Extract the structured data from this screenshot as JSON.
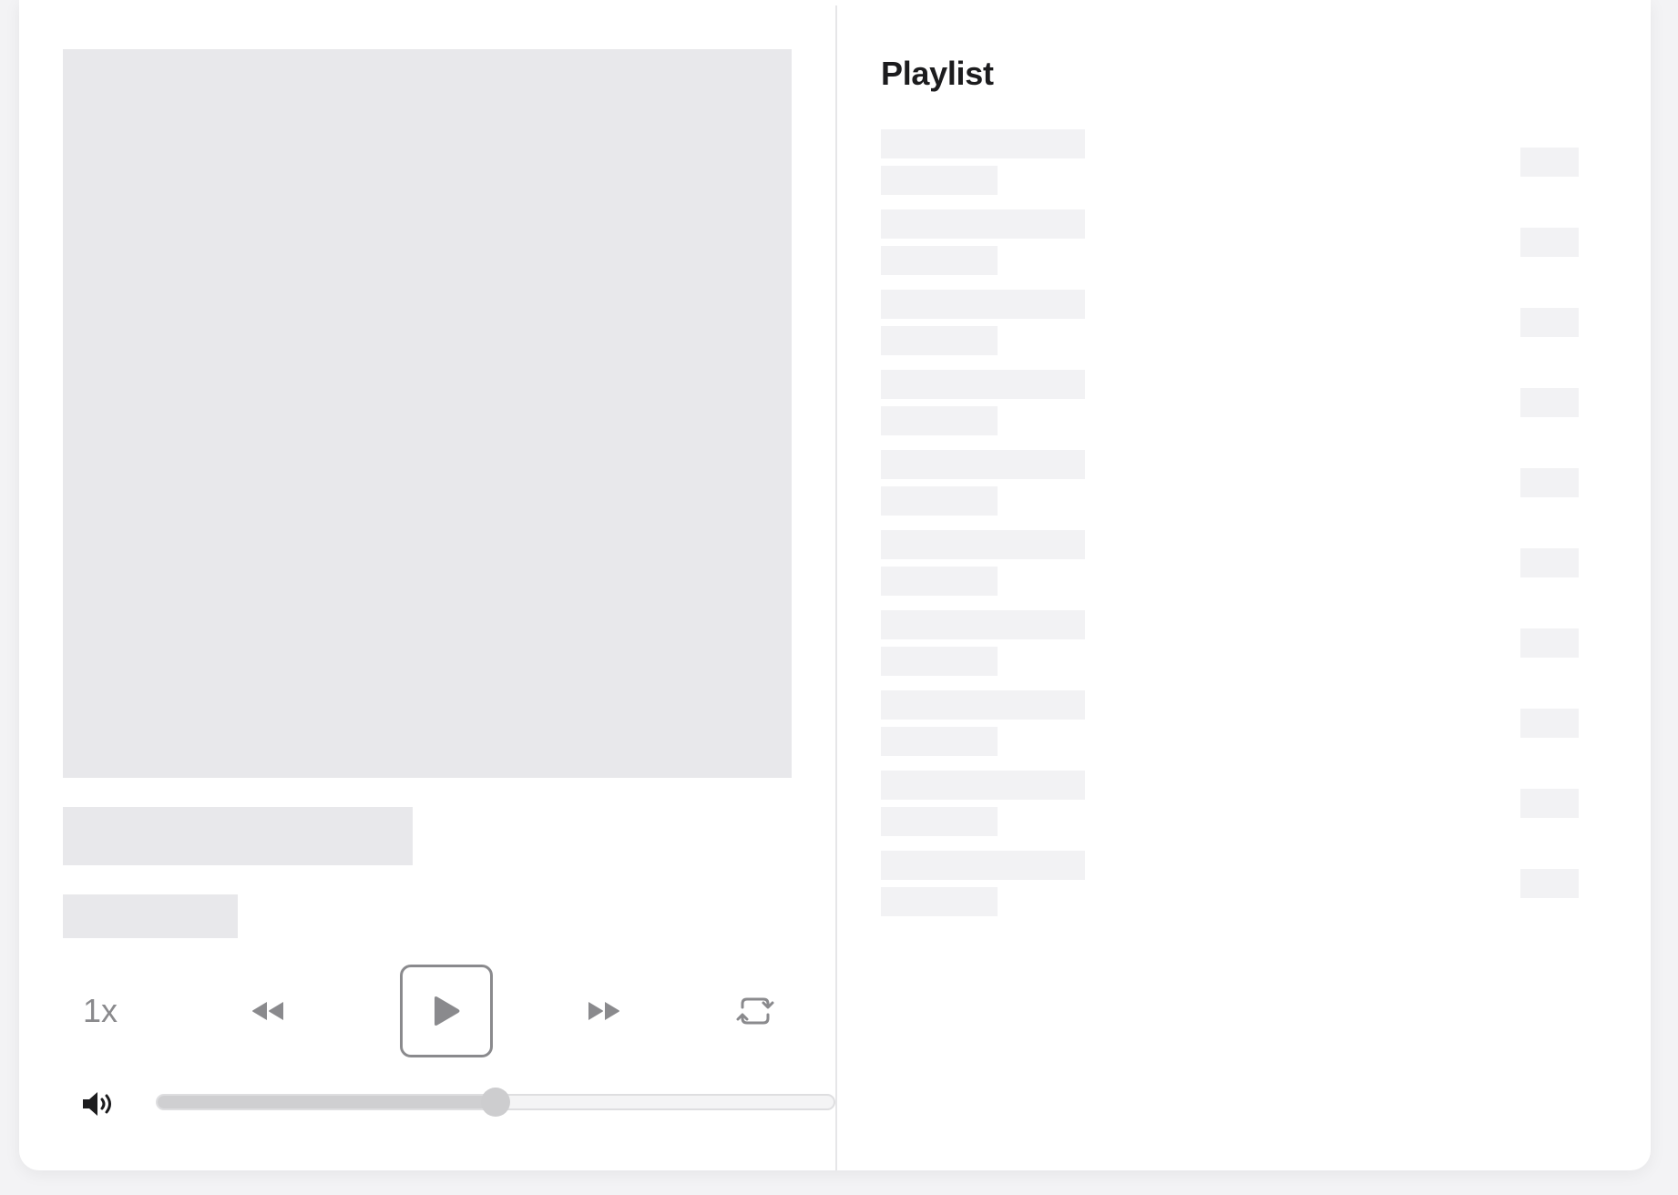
{
  "player": {
    "speed_label": "1x",
    "volume_level": 0.5
  },
  "playlist": {
    "title": "Playlist",
    "track_count": 10
  },
  "icons": {
    "rewind": "rewind-icon",
    "play": "play-icon",
    "fast_forward": "fast-forward-icon",
    "loop": "loop-icon",
    "volume": "volume-icon"
  },
  "colors": {
    "skeleton": "#e8e8eb",
    "skeleton_light": "#f2f2f4",
    "control": "#8a8a8d"
  }
}
